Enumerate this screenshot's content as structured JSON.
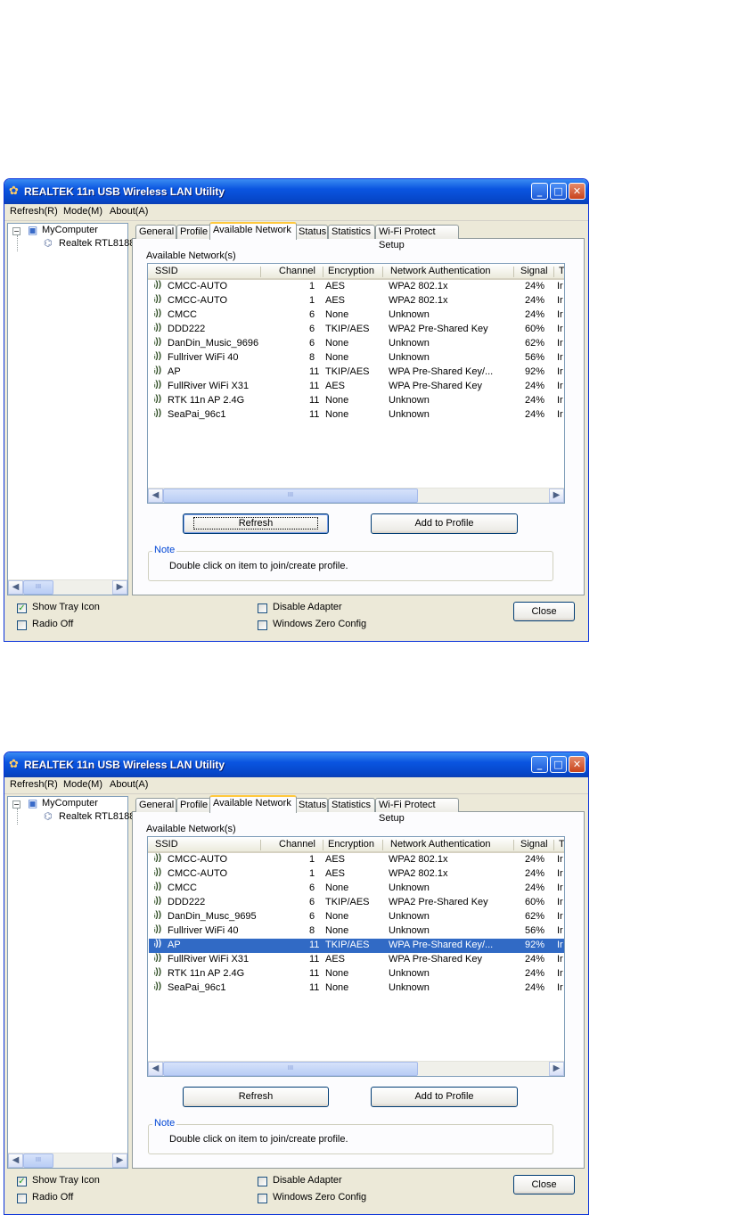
{
  "windows": [
    {
      "title": "REALTEK 11n USB Wireless LAN Utility",
      "menu": [
        "Refresh(R)",
        "Mode(M)",
        "About(A)"
      ],
      "tree": {
        "root": "MyComputer",
        "child": "Realtek RTL8188"
      },
      "tabs": [
        "General",
        "Profile",
        "Available Network",
        "Status",
        "Statistics",
        "Wi-Fi Protect Setup"
      ],
      "active_tab": "Available Network",
      "group_label": "Available Network(s)",
      "columns": [
        "SSID",
        "Channel",
        "Encryption",
        "Network Authentication",
        "Signal",
        "T"
      ],
      "networks": [
        {
          "ssid": "CMCC-AUTO",
          "channel": "1",
          "encryption": "AES",
          "auth": "WPA2 802.1x",
          "signal": "24%",
          "type": "Ir"
        },
        {
          "ssid": "CMCC-AUTO",
          "channel": "1",
          "encryption": "AES",
          "auth": "WPA2 802.1x",
          "signal": "24%",
          "type": "Ir"
        },
        {
          "ssid": "CMCC",
          "channel": "6",
          "encryption": "None",
          "auth": "Unknown",
          "signal": "24%",
          "type": "Ir"
        },
        {
          "ssid": "DDD222",
          "channel": "6",
          "encryption": "TKIP/AES",
          "auth": "WPA2 Pre-Shared Key",
          "signal": "60%",
          "type": "Ir"
        },
        {
          "ssid": "DanDin_Music_9696",
          "channel": "6",
          "encryption": "None",
          "auth": "Unknown",
          "signal": "62%",
          "type": "Ir"
        },
        {
          "ssid": "Fullriver WiFi 40",
          "channel": "8",
          "encryption": "None",
          "auth": "Unknown",
          "signal": "56%",
          "type": "Ir"
        },
        {
          "ssid": "AP",
          "channel": "11",
          "encryption": "TKIP/AES",
          "auth": "WPA Pre-Shared Key/...",
          "signal": "92%",
          "type": "Ir"
        },
        {
          "ssid": "FullRiver WiFi X31",
          "channel": "11",
          "encryption": "AES",
          "auth": "WPA Pre-Shared Key",
          "signal": "24%",
          "type": "Ir"
        },
        {
          "ssid": "RTK 11n AP 2.4G",
          "channel": "11",
          "encryption": "None",
          "auth": "Unknown",
          "signal": "24%",
          "type": "Ir"
        },
        {
          "ssid": "SeaPai_96c1",
          "channel": "11",
          "encryption": "None",
          "auth": "Unknown",
          "signal": "24%",
          "type": "Ir"
        }
      ],
      "selected_row": null,
      "buttons": {
        "refresh": "Refresh",
        "add_to_profile": "Add to Profile",
        "close": "Close"
      },
      "note_title": "Note",
      "note_text": "Double click on item to join/create profile.",
      "checkboxes": {
        "show_tray_icon": "Show Tray Icon",
        "radio_off": "Radio Off",
        "disable_adapter": "Disable Adapter",
        "windows_zero_config": "Windows Zero Config"
      },
      "checked": {
        "show_tray_icon": true,
        "radio_off": false,
        "disable_adapter": false,
        "windows_zero_config": false
      },
      "scroll_glyph": "III"
    },
    {
      "title": "REALTEK 11n USB Wireless LAN Utility",
      "menu": [
        "Refresh(R)",
        "Mode(M)",
        "About(A)"
      ],
      "tree": {
        "root": "MyComputer",
        "child": "Realtek RTL8188"
      },
      "tabs": [
        "General",
        "Profile",
        "Available Network",
        "Status",
        "Statistics",
        "Wi-Fi Protect Setup"
      ],
      "active_tab": "Available Network",
      "group_label": "Available Network(s)",
      "columns": [
        "SSID",
        "Channel",
        "Encryption",
        "Network Authentication",
        "Signal",
        "T"
      ],
      "networks": [
        {
          "ssid": "CMCC-AUTO",
          "channel": "1",
          "encryption": "AES",
          "auth": "WPA2 802.1x",
          "signal": "24%",
          "type": "Ir"
        },
        {
          "ssid": "CMCC-AUTO",
          "channel": "1",
          "encryption": "AES",
          "auth": "WPA2 802.1x",
          "signal": "24%",
          "type": "Ir"
        },
        {
          "ssid": "CMCC",
          "channel": "6",
          "encryption": "None",
          "auth": "Unknown",
          "signal": "24%",
          "type": "Ir"
        },
        {
          "ssid": "DDD222",
          "channel": "6",
          "encryption": "TKIP/AES",
          "auth": "WPA2 Pre-Shared Key",
          "signal": "60%",
          "type": "Ir"
        },
        {
          "ssid": "DanDin_Musc_9695",
          "channel": "6",
          "encryption": "None",
          "auth": "Unknown",
          "signal": "62%",
          "type": "Ir"
        },
        {
          "ssid": "Fullriver WiFi 40",
          "channel": "8",
          "encryption": "None",
          "auth": "Unknown",
          "signal": "56%",
          "type": "Ir"
        },
        {
          "ssid": "AP",
          "channel": "11",
          "encryption": "TKIP/AES",
          "auth": "WPA Pre-Shared Key/...",
          "signal": "92%",
          "type": "Ir"
        },
        {
          "ssid": "FullRiver WiFi X31",
          "channel": "11",
          "encryption": "AES",
          "auth": "WPA Pre-Shared Key",
          "signal": "24%",
          "type": "Ir"
        },
        {
          "ssid": "RTK 11n AP 2.4G",
          "channel": "11",
          "encryption": "None",
          "auth": "Unknown",
          "signal": "24%",
          "type": "Ir"
        },
        {
          "ssid": "SeaPai_96c1",
          "channel": "11",
          "encryption": "None",
          "auth": "Unknown",
          "signal": "24%",
          "type": "Ir"
        }
      ],
      "selected_row": 6,
      "buttons": {
        "refresh": "Refresh",
        "add_to_profile": "Add to Profile",
        "close": "Close"
      },
      "note_title": "Note",
      "note_text": "Double click on item to join/create profile.",
      "checkboxes": {
        "show_tray_icon": "Show Tray Icon",
        "radio_off": "Radio Off",
        "disable_adapter": "Disable Adapter",
        "windows_zero_config": "Windows Zero Config"
      },
      "checked": {
        "show_tray_icon": true,
        "radio_off": false,
        "disable_adapter": false,
        "windows_zero_config": false
      },
      "scroll_glyph": "III"
    }
  ],
  "colors": {
    "selection": "#316ac5",
    "titlebar": "#0a55e0",
    "note_title": "#0046d5"
  }
}
